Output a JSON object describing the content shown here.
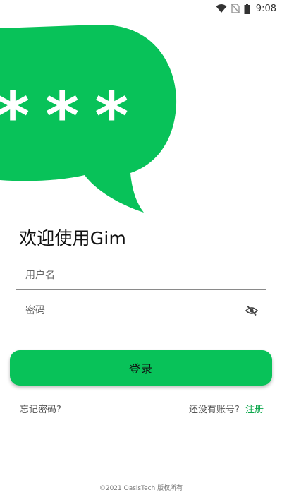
{
  "status_bar": {
    "time": "9:08"
  },
  "hero": {
    "mask_text": "***"
  },
  "login": {
    "welcome": "欢迎使用Gim",
    "username_placeholder": "用户名",
    "username_value": "",
    "password_placeholder": "密码",
    "password_value": "",
    "submit_label": "登录",
    "forgot_label": "忘记密码?",
    "no_account_label": "还没有账号?",
    "register_label": "注册"
  },
  "footer": {
    "copyright": "©2021 OasisTech 版权所有"
  },
  "colors": {
    "accent": "#08c259",
    "link": "#0aa64a"
  }
}
